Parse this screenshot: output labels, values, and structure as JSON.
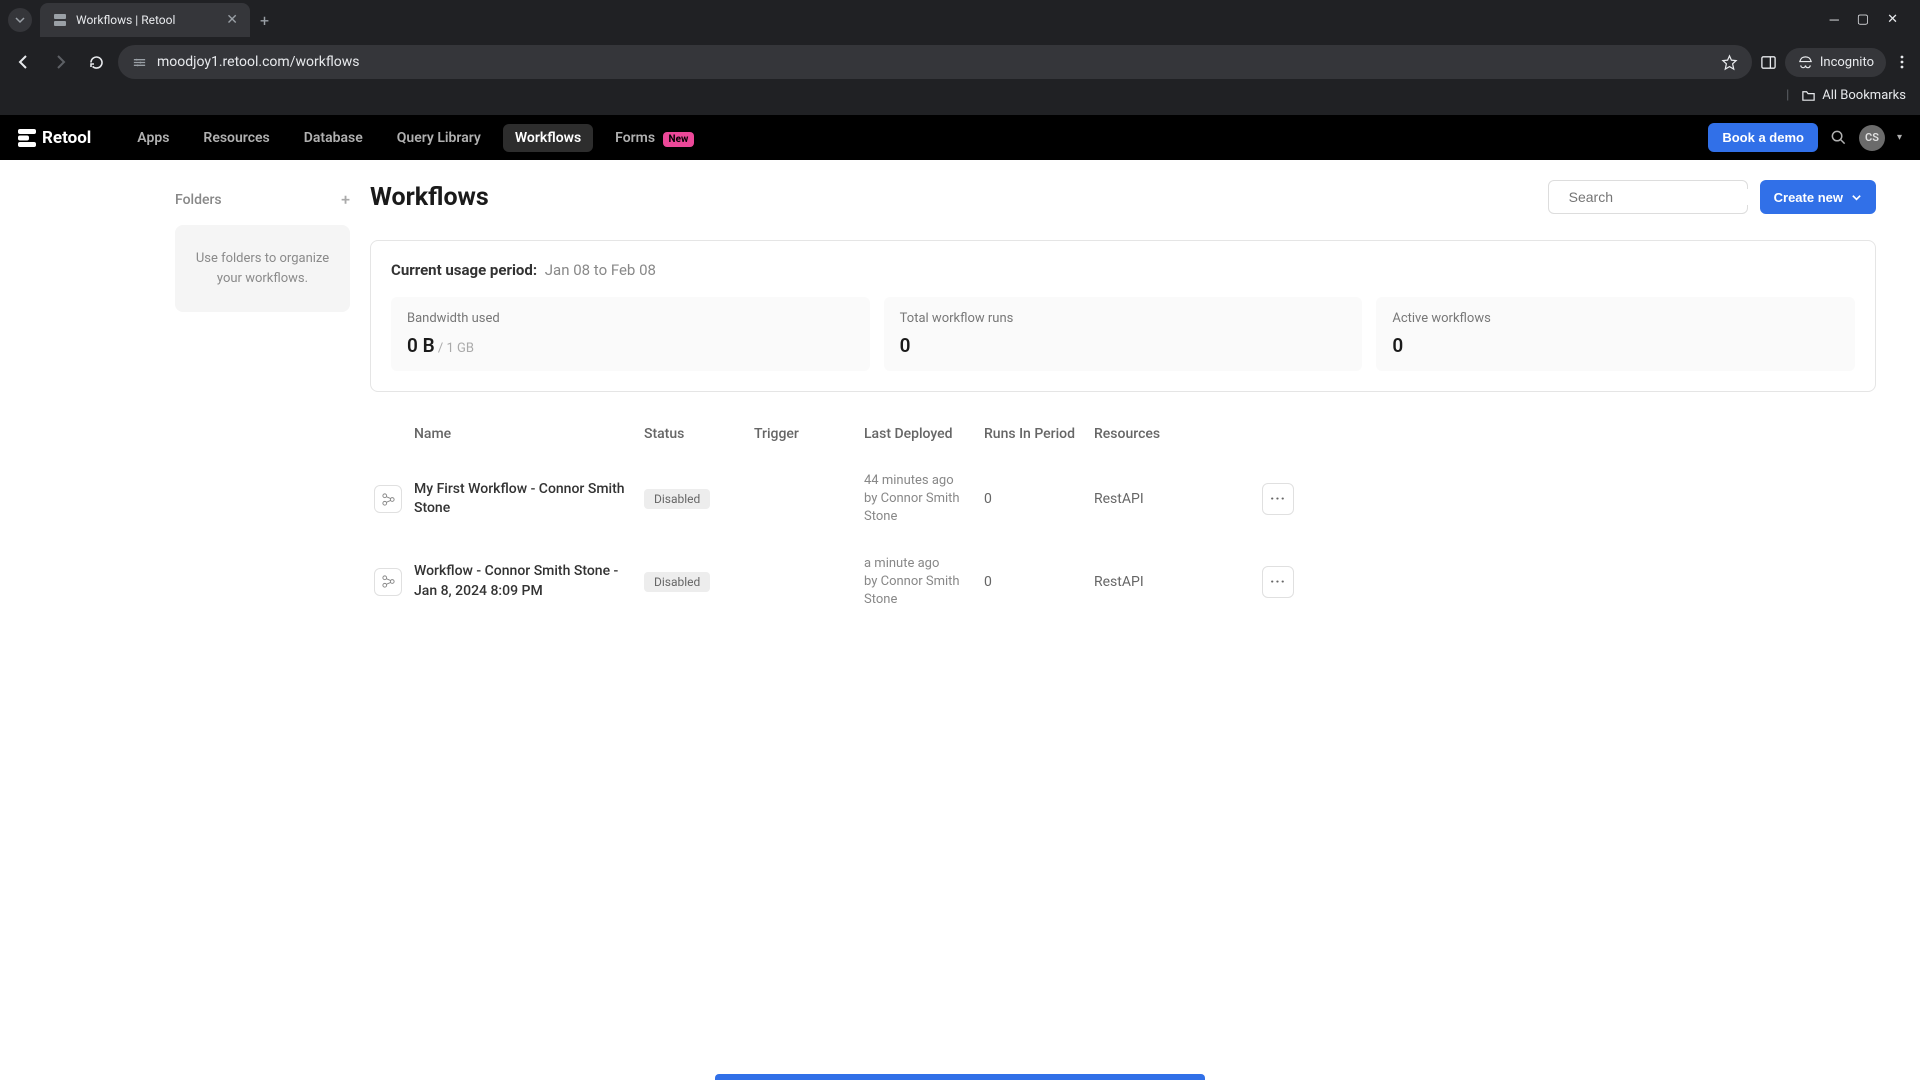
{
  "browser": {
    "tab_title": "Workflows | Retool",
    "url": "moodjoy1.retool.com/workflows",
    "incognito": "Incognito",
    "all_bookmarks": "All Bookmarks"
  },
  "nav": {
    "logo": "Retool",
    "links": [
      "Apps",
      "Resources",
      "Database",
      "Query Library",
      "Workflows",
      "Forms"
    ],
    "forms_badge": "New",
    "book_demo": "Book a demo",
    "avatar": "CS"
  },
  "sidebar": {
    "folders_label": "Folders",
    "empty_text": "Use folders to organize your workflows."
  },
  "page": {
    "title": "Workflows",
    "search_placeholder": "Search",
    "create_label": "Create new"
  },
  "usage": {
    "period_label": "Current usage period:",
    "period_value": "Jan 08 to Feb 08",
    "stats": [
      {
        "label": "Bandwidth used",
        "value": "0 B",
        "max": " / 1 GB"
      },
      {
        "label": "Total workflow runs",
        "value": "0",
        "max": ""
      },
      {
        "label": "Active workflows",
        "value": "0",
        "max": ""
      }
    ]
  },
  "table": {
    "headers": [
      "Name",
      "Status",
      "Trigger",
      "Last Deployed",
      "Runs In Period",
      "Resources"
    ],
    "rows": [
      {
        "name": "My First Workflow - Connor Smith Stone",
        "status": "Disabled",
        "trigger": "",
        "deployed_time": "44 minutes ago",
        "deployed_by": "by Connor Smith Stone",
        "runs": "0",
        "resources": "RestAPI"
      },
      {
        "name": "Workflow - Connor Smith Stone - Jan 8, 2024 8:09 PM",
        "status": "Disabled",
        "trigger": "",
        "deployed_time": "a minute ago",
        "deployed_by": "by Connor Smith Stone",
        "runs": "0",
        "resources": "RestAPI"
      }
    ]
  }
}
